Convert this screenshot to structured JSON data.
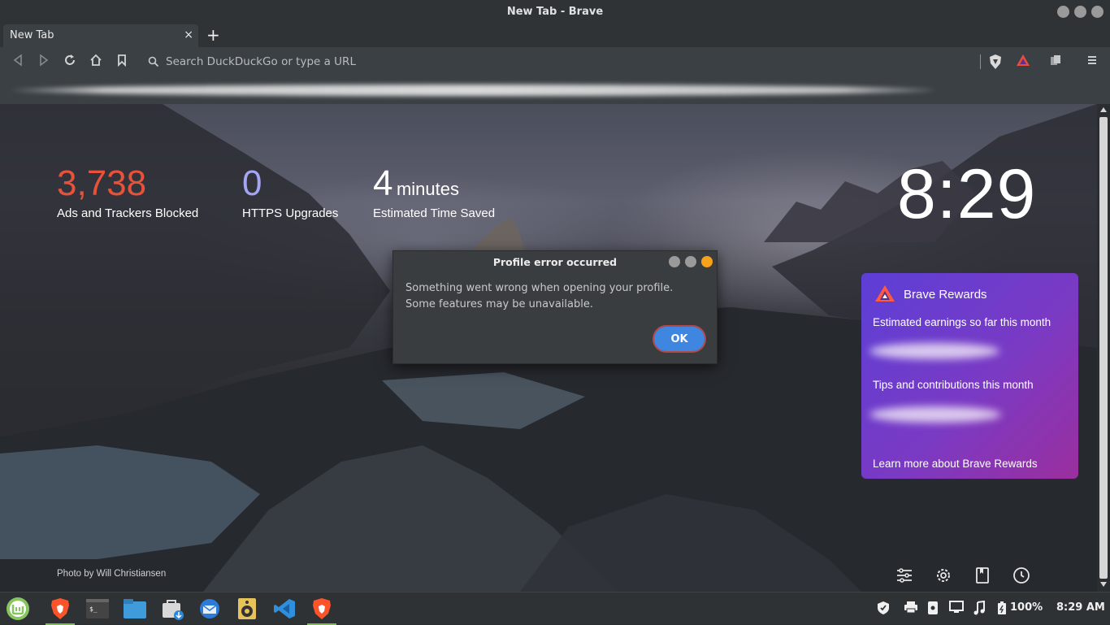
{
  "window": {
    "title": "New Tab - Brave"
  },
  "tabs": [
    {
      "title": "New Tab",
      "close": "×"
    }
  ],
  "new_tab_label": "+",
  "toolbar": {
    "url_placeholder": "Search DuckDuckGo or type a URL"
  },
  "stats": {
    "ads_blocked": {
      "value": "3,738",
      "label": "Ads and Trackers Blocked",
      "color": "#e8513a"
    },
    "https_upgrades": {
      "value": "0",
      "label": "HTTPS Upgrades",
      "color": "#a6a5f5"
    },
    "time_saved": {
      "value": "4",
      "unit": "minutes",
      "label": "Estimated Time Saved"
    }
  },
  "clock": "8:29",
  "rewards": {
    "title": "Brave Rewards",
    "earnings_label": "Estimated earnings so far this month",
    "tips_label": "Tips and contributions this month",
    "learn_more": "Learn more about Brave Rewards"
  },
  "photo_credit": "Photo by Will Christiansen",
  "dialog": {
    "title": "Profile error occurred",
    "message": "Something went wrong when opening your profile. Some features may be unavailable.",
    "ok_label": "OK"
  },
  "taskbar": {
    "apps": [
      "menu-icon",
      "brave-icon",
      "terminal-icon",
      "files-icon",
      "software-manager-icon",
      "thunderbird-icon",
      "rhythmbox-icon",
      "vscode-icon",
      "brave-icon"
    ],
    "battery": "100%",
    "time": "8:29 AM"
  },
  "colors": {
    "accent_blue": "#3f86e0",
    "rewards_gradient_start": "#5c3fd6",
    "rewards_gradient_end": "#9b2f9e",
    "mint_green": "#7bbf4a"
  }
}
